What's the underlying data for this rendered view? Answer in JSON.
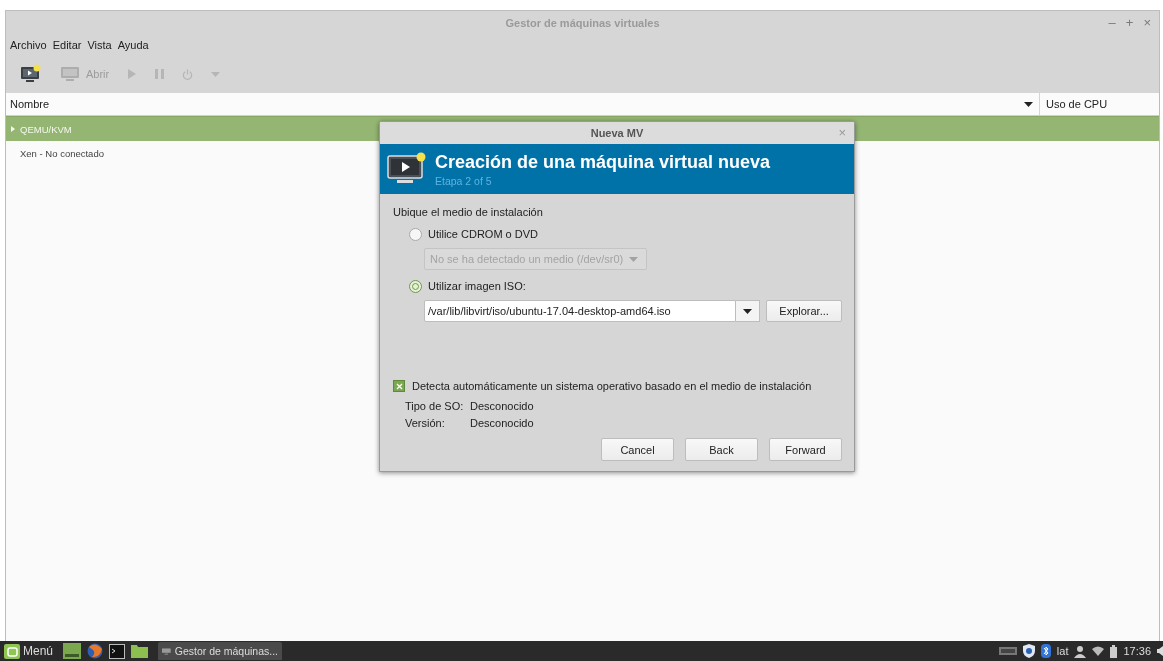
{
  "window": {
    "title": "Gestor de máquinas virtuales",
    "controls": [
      "–",
      "+",
      "×"
    ]
  },
  "menu": [
    "Archivo",
    "Editar",
    "Vista",
    "Ayuda"
  ],
  "toolbar": [
    {
      "kind": "new",
      "disabled": false
    },
    {
      "kind": "open",
      "label": "Abrir",
      "disabled": true
    },
    {
      "kind": "play",
      "disabled": true
    },
    {
      "kind": "pause",
      "disabled": true
    },
    {
      "kind": "power",
      "disabled": true
    },
    {
      "kind": "more",
      "disabled": true
    }
  ],
  "table": {
    "columns": [
      "Nombre",
      "Uso de CPU"
    ],
    "rows": [
      {
        "label": "QEMU/KVM",
        "selected": true,
        "expanded": false
      },
      {
        "label": "Xen - No conectado",
        "selected": false
      }
    ]
  },
  "dialog": {
    "title": "Nueva MV",
    "close": "×",
    "heading": "Creación de una máquina virtual nueva",
    "step": "Etapa 2 of 5",
    "section": "Ubique el medio de instalación",
    "options": [
      {
        "label": "Utilice CDROM o DVD",
        "selected": false,
        "kind": "dropdown",
        "value": "No se ha detectado un medio (/dev/sr0)",
        "disabled": true
      },
      {
        "label": "Utilizar imagen ISO:",
        "selected": true,
        "kind": "combo",
        "value": "/var/lib/libvirt/iso/ubuntu-17.04-desktop-amd64.iso",
        "button": "Explorar..."
      }
    ],
    "autodetect": {
      "label": "Detecta automáticamente un sistema operativo basado en el medio de instalación",
      "checked": true
    },
    "info": [
      {
        "label": "Tipo de SO:",
        "value": "Desconocido"
      },
      {
        "label": "Versión:",
        "value": "Desconocido"
      }
    ],
    "buttons": [
      "Cancel",
      "Back",
      "Forward"
    ]
  },
  "taskbar": {
    "menu": "Menú",
    "window": "Gestor de máquinas...",
    "layout": "lat",
    "time": "17:36"
  }
}
